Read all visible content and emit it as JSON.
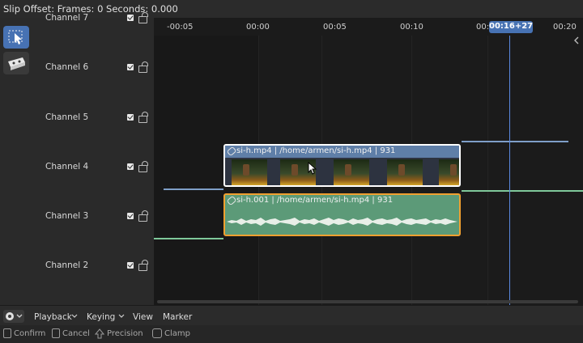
{
  "header": {
    "title": "Slip Offset: Frames: 0 Seconds: 0.000"
  },
  "toolbar": {
    "tools": [
      "select-box-icon",
      "blade-icon"
    ]
  },
  "channels": [
    {
      "label": "Channel 7"
    },
    {
      "label": "Channel 6"
    },
    {
      "label": "Channel 5"
    },
    {
      "label": "Channel 4"
    },
    {
      "label": "Channel 3"
    },
    {
      "label": "Channel 2"
    }
  ],
  "timeline": {
    "ticks": [
      "-00:05",
      "00:00",
      "00:05",
      "00:10",
      "00:15",
      "00:20"
    ],
    "playhead": "00:16+27"
  },
  "strips": {
    "movie": {
      "label": "si-h.mp4 | /home/armen/si-h.mp4 | 931",
      "color": "#5f7fa8"
    },
    "sound": {
      "label": "si-h.001 | /home/armen/si-h.mp4 | 931",
      "color": "#5c9a78"
    }
  },
  "menubar": {
    "playback": "Playback",
    "keying": "Keying",
    "view": "View",
    "marker": "Marker"
  },
  "status": {
    "confirm": "Confirm",
    "cancel": "Cancel",
    "precision": "Precision",
    "clamp": "Clamp"
  }
}
